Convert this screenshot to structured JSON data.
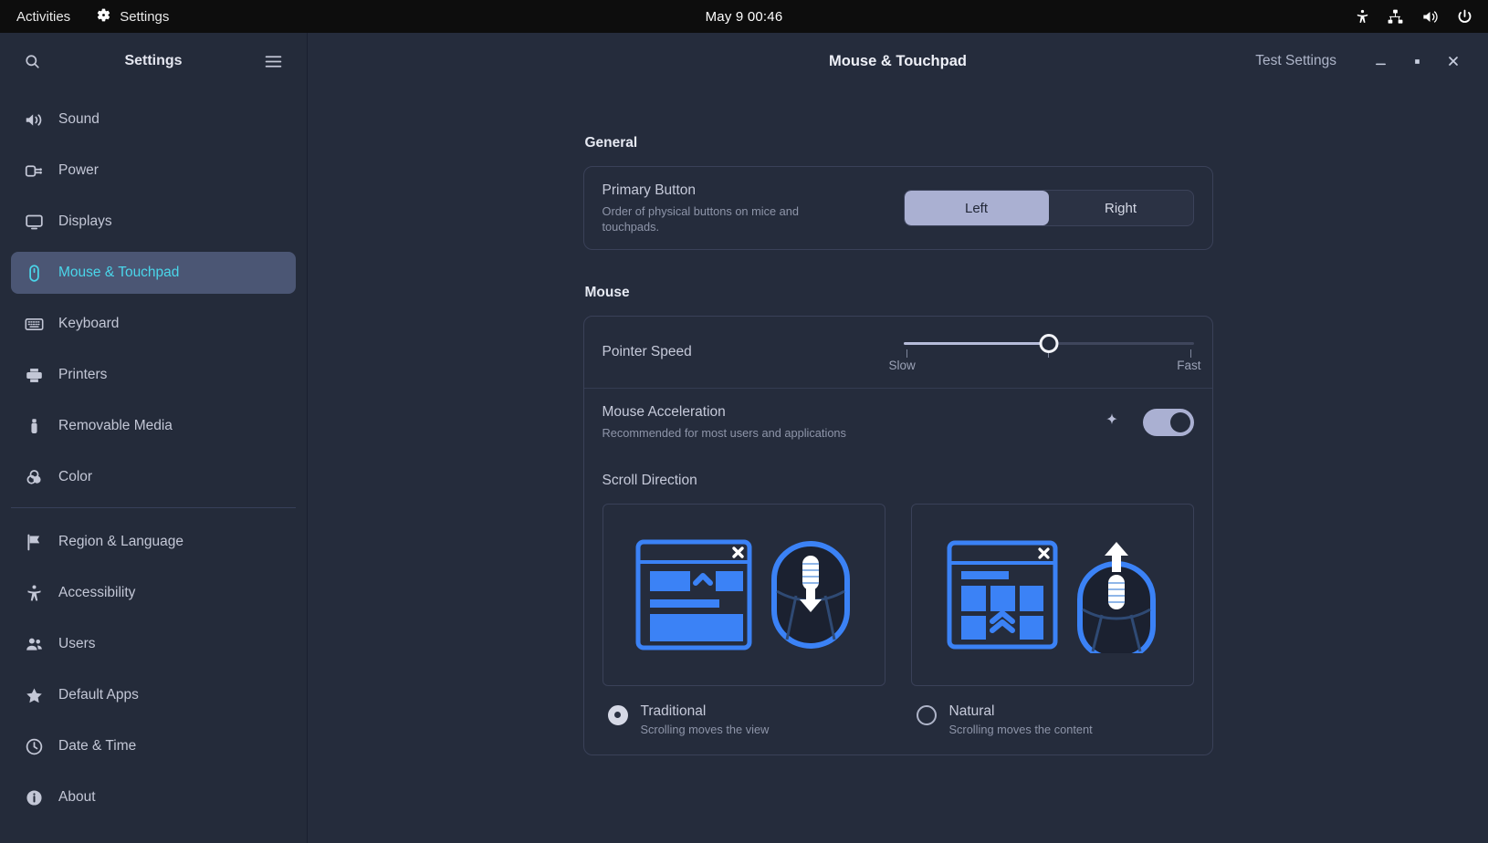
{
  "topbar": {
    "activities": "Activities",
    "app_name": "Settings",
    "app_icon": "gear-icon",
    "clock": "May 9  00:46",
    "indicators": [
      "accessibility-icon",
      "network-icon",
      "volume-icon",
      "power-icon"
    ]
  },
  "sidebar": {
    "title": "Settings",
    "search_icon": "search-icon",
    "menu_icon": "hamburger-menu-icon",
    "items": [
      {
        "label": "Sound",
        "icon": "speaker-icon",
        "active": false
      },
      {
        "label": "Power",
        "icon": "power-plug-icon",
        "active": false
      },
      {
        "label": "Displays",
        "icon": "monitor-icon",
        "active": false
      },
      {
        "label": "Mouse & Touchpad",
        "icon": "mouse-icon",
        "active": true
      },
      {
        "label": "Keyboard",
        "icon": "keyboard-icon",
        "active": false
      },
      {
        "label": "Printers",
        "icon": "printer-icon",
        "active": false
      },
      {
        "label": "Removable Media",
        "icon": "usb-drive-icon",
        "active": false
      },
      {
        "label": "Color",
        "icon": "color-circles-icon",
        "active": false
      },
      {
        "label": "Region & Language",
        "icon": "flag-icon",
        "active": false
      },
      {
        "label": "Accessibility",
        "icon": "accessibility-icon",
        "active": false
      },
      {
        "label": "Users",
        "icon": "users-icon",
        "active": false
      },
      {
        "label": "Default Apps",
        "icon": "star-icon",
        "active": false
      },
      {
        "label": "Date & Time",
        "icon": "clock-icon",
        "active": false
      },
      {
        "label": "About",
        "icon": "info-icon",
        "active": false
      }
    ],
    "separator_after_index": 7
  },
  "headerbar": {
    "title": "Mouse & Touchpad",
    "test_settings": "Test Settings",
    "minimize": "minimize-icon",
    "maximize": "maximize-icon",
    "close": "close-icon"
  },
  "general": {
    "section": "General",
    "primary_button": {
      "title": "Primary Button",
      "subtitle": "Order of physical buttons on mice and touchpads.",
      "options": [
        "Left",
        "Right"
      ],
      "selected": "Left"
    }
  },
  "mouse": {
    "section": "Mouse",
    "pointer_speed": {
      "title": "Pointer Speed",
      "min_label": "Slow",
      "max_label": "Fast",
      "value_percent": 50
    },
    "acceleration": {
      "title": "Mouse Acceleration",
      "subtitle": "Recommended for most users and applications",
      "badge_icon": "sparkle-icon",
      "enabled": true
    },
    "scroll_direction": {
      "title": "Scroll Direction",
      "options": [
        {
          "label": "Traditional",
          "subtitle": "Scrolling moves the view",
          "selected": true,
          "illustration": "window-scrollbar-and-mouse-down-arrow"
        },
        {
          "label": "Natural",
          "subtitle": "Scrolling moves the content",
          "selected": false,
          "illustration": "window-tiles-and-mouse-up-arrow"
        }
      ]
    }
  },
  "colors": {
    "accent_blue": "#3b82f6",
    "active_text": "#4ad6ea",
    "active_bg": "#4b5674",
    "toggle_on": "#aab0d2",
    "window_bg": "#252c3c",
    "sidebar_bg": "#242b3a",
    "topbar_bg": "#0d0d0d"
  }
}
